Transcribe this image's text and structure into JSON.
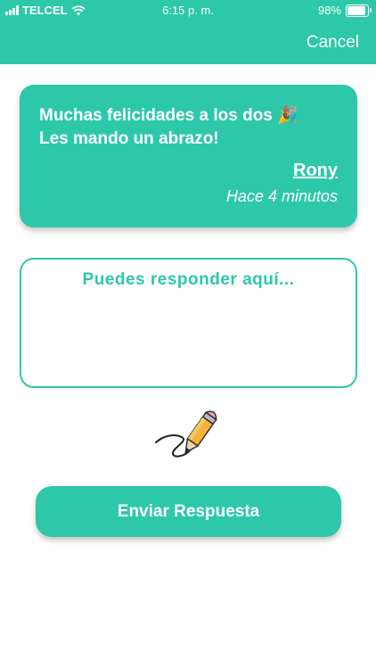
{
  "status_bar": {
    "carrier": "TELCEL",
    "time": "6:15 p. m.",
    "battery": "98%",
    "battery_level": 0.98
  },
  "header": {
    "cancel_label": "Cancel"
  },
  "message_card": {
    "line1": "Muchas felicidades a los dos 🎉",
    "line2": "Les mando un abrazo!",
    "author": "Rony",
    "time_ago": "Hace 4 minutos"
  },
  "reply": {
    "placeholder": "Puedes responder aquí...",
    "value": ""
  },
  "illustration": {
    "icon": "pencil-icon"
  },
  "actions": {
    "send_label": "Enviar Respuesta"
  },
  "colors": {
    "accent": "#2dc8a9",
    "text_on_accent": "#ffffff"
  }
}
